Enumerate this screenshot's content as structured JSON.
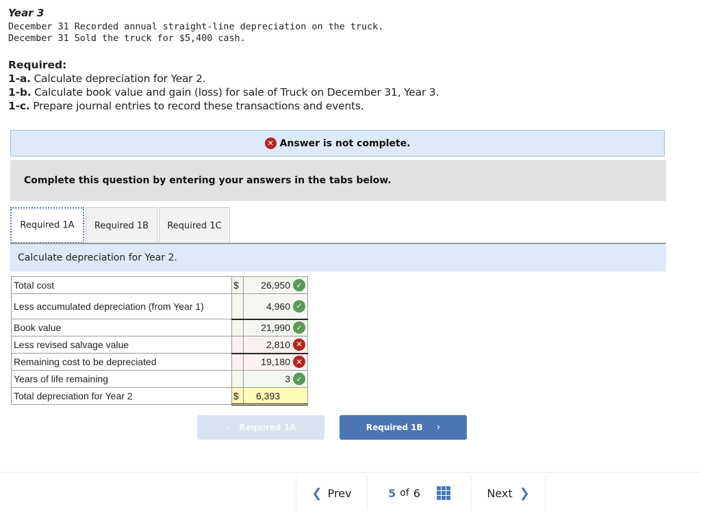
{
  "problem": {
    "year_heading": "Year 3",
    "events": [
      "December 31 Recorded annual straight-line depreciation on the truck.",
      "December 31 Sold the truck for $5,400 cash."
    ],
    "required_heading": "Required:",
    "requirements": [
      {
        "id": "1-a.",
        "text": " Calculate depreciation for Year 2."
      },
      {
        "id": "1-b.",
        "text": " Calculate book value and gain (loss) for sale of Truck on December 31, Year 3."
      },
      {
        "id": "1-c.",
        "text": " Prepare journal entries to record these transactions and events."
      }
    ]
  },
  "status": {
    "message": "Answer is not complete.",
    "icon": "x-circle-icon",
    "color": "#b3261e"
  },
  "instruction": "Complete this question by entering your answers in the tabs below.",
  "tabs": [
    {
      "label": "Required 1A",
      "active": true
    },
    {
      "label": "Required 1B",
      "active": false
    },
    {
      "label": "Required 1C",
      "active": false
    }
  ],
  "prompt": "Calculate depreciation for Year 2.",
  "table": {
    "rows": [
      {
        "label": "Total cost",
        "currency": "$",
        "value": "26,950",
        "status": "correct"
      },
      {
        "label": "Less accumulated depreciation (from Year 1)",
        "currency": "",
        "value": "4,960",
        "status": "correct"
      },
      {
        "label": "Book value",
        "currency": "",
        "value": "21,990",
        "status": "correct"
      },
      {
        "label": "Less revised salvage value",
        "currency": "",
        "value": "2,810",
        "status": "incorrect"
      },
      {
        "label": "Remaining cost to be depreciated",
        "currency": "",
        "value": "19,180",
        "status": "incorrect"
      },
      {
        "label": "Years of life remaining",
        "currency": "",
        "value": "3",
        "status": "correct"
      },
      {
        "label": "Total depreciation for Year 2",
        "currency": "$",
        "value": "6,393",
        "status": "none"
      }
    ],
    "colors": {
      "correct": "#5a9a55",
      "incorrect": "#b3261e",
      "highlight": "#fdf9b8"
    }
  },
  "tab_nav": {
    "prev_label": "Required 1A",
    "next_label": "Required 1B",
    "prev_chevron": "‹",
    "next_chevron": "›",
    "accent": "#4a76b5"
  },
  "pager": {
    "prev_label": "Prev",
    "current": "5",
    "of_label": "of",
    "total": "6",
    "next_label": "Next",
    "prev_chevron": "❮",
    "next_chevron": "❯"
  }
}
